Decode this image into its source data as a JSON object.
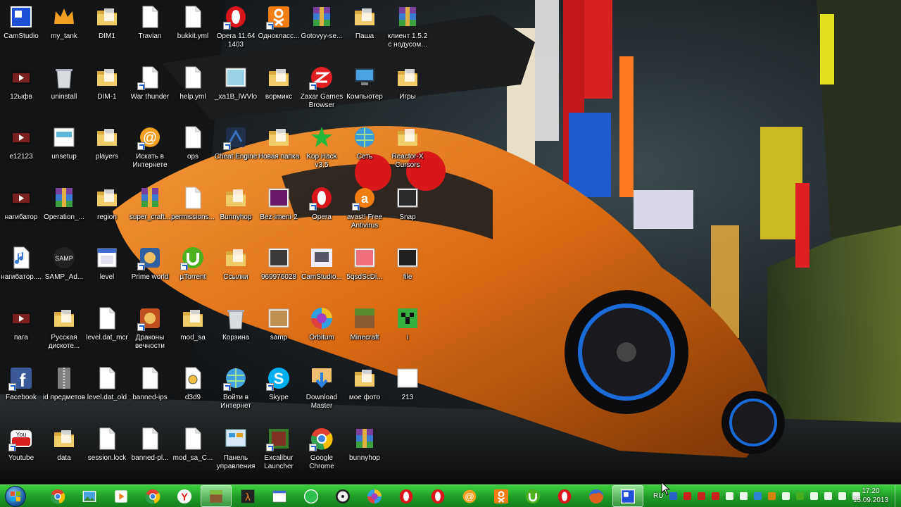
{
  "desktop": {
    "icons": [
      {
        "label": "CamStudio",
        "icon": "camstudio-icon",
        "color": "#1d4fd8",
        "shortcut": false
      },
      {
        "label": "my_tank",
        "icon": "tank-crown-icon",
        "color": "#f0a020",
        "shortcut": false
      },
      {
        "label": "DIM1",
        "icon": "folder-icon",
        "color": "#f1cd69",
        "shortcut": false
      },
      {
        "label": "Travian",
        "icon": "file-icon",
        "color": "#ffffff",
        "shortcut": false
      },
      {
        "label": "bukkit.yml",
        "icon": "file-icon",
        "color": "#ffffff",
        "shortcut": false
      },
      {
        "label": "Opera 11.64 1403",
        "icon": "opera-icon",
        "color": "#d9151b",
        "shortcut": true
      },
      {
        "label": "Однокласс...",
        "icon": "odnoklassniki-icon",
        "color": "#f57e14",
        "shortcut": true
      },
      {
        "label": "Gotovyy-se...",
        "icon": "winrar-icon",
        "color": "#7b3fa0",
        "shortcut": false
      },
      {
        "label": "Паша",
        "icon": "folder-icon",
        "color": "#f1cd69",
        "shortcut": false
      },
      {
        "label": "клиент 1.5.2 с нодусом...",
        "icon": "winrar-icon",
        "color": "#7b3fa0",
        "shortcut": false
      },
      {
        "label": "12ыфв",
        "icon": "video-file-icon",
        "color": "#ffffff",
        "shortcut": false
      },
      {
        "label": "uninstall",
        "icon": "recycle-bin-icon",
        "color": "#c8c8c8",
        "shortcut": false
      },
      {
        "label": "DIM-1",
        "icon": "folder-icon",
        "color": "#f1cd69",
        "shortcut": false
      },
      {
        "label": "War thunder",
        "icon": "file-icon",
        "color": "#ffffff",
        "shortcut": true
      },
      {
        "label": "help.yml",
        "icon": "file-icon",
        "color": "#ffffff",
        "shortcut": false
      },
      {
        "label": "_xa1B_lWVlo",
        "icon": "image-file-icon",
        "color": "#9ad0e8",
        "shortcut": false
      },
      {
        "label": "вормикс",
        "icon": "folder-icon",
        "color": "#f1cd69",
        "shortcut": false
      },
      {
        "label": "Zaxar Games Browser",
        "icon": "zaxar-icon",
        "color": "#e02020",
        "shortcut": true
      },
      {
        "label": "Компьютер",
        "icon": "computer-icon",
        "color": "#4aa3e0",
        "shortcut": false
      },
      {
        "label": "Игры",
        "icon": "folder-icon",
        "color": "#f1cd69",
        "shortcut": false
      },
      {
        "label": "e12123",
        "icon": "video-file-icon",
        "color": "#ffffff",
        "shortcut": false
      },
      {
        "label": "unsetup",
        "icon": "setup-window-icon",
        "color": "#5fb8d8",
        "shortcut": false
      },
      {
        "label": "players",
        "icon": "folder-icon",
        "color": "#f1cd69",
        "shortcut": false
      },
      {
        "label": "Искать в Интернете",
        "icon": "mail-at-icon",
        "color": "#f5a020",
        "shortcut": true
      },
      {
        "label": "ops",
        "icon": "file-icon",
        "color": "#ffffff",
        "shortcut": false
      },
      {
        "label": "Cheat Engine",
        "icon": "cheat-engine-icon",
        "color": "#3a70c0",
        "shortcut": true
      },
      {
        "label": "Новая папка",
        "icon": "folder-icon",
        "color": "#f1cd69",
        "shortcut": false
      },
      {
        "label": "Kop Hack v3.5",
        "icon": "star-icon",
        "color": "#22b83a",
        "shortcut": false
      },
      {
        "label": "Сеть",
        "icon": "network-globe-icon",
        "color": "#3a9ad9",
        "shortcut": false
      },
      {
        "label": "Reactor-X Cursors",
        "icon": "folder-icon",
        "color": "#f1cd69",
        "shortcut": false
      },
      {
        "label": "нагибатор",
        "icon": "video-file-icon",
        "color": "#ffffff",
        "shortcut": false
      },
      {
        "label": "Operation_...",
        "icon": "winrar-icon",
        "color": "#7b3fa0",
        "shortcut": false
      },
      {
        "label": "region",
        "icon": "folder-icon",
        "color": "#f1cd69",
        "shortcut": false
      },
      {
        "label": "super_craft...",
        "icon": "winrar-icon",
        "color": "#7b3fa0",
        "shortcut": false
      },
      {
        "label": "permissions...",
        "icon": "file-icon",
        "color": "#ffffff",
        "shortcut": false
      },
      {
        "label": "Bunnyhop",
        "icon": "folder-icon",
        "color": "#f1cd69",
        "shortcut": false
      },
      {
        "label": "Bez-imeni-2",
        "icon": "image-file-icon",
        "color": "#6a1a6a",
        "shortcut": false
      },
      {
        "label": "Opera",
        "icon": "opera-icon",
        "color": "#d9151b",
        "shortcut": true
      },
      {
        "label": "avast! Free Antivirus",
        "icon": "avast-icon",
        "color": "#f07d12",
        "shortcut": true
      },
      {
        "label": "Snap",
        "icon": "image-file-icon",
        "color": "#2a2a2a",
        "shortcut": false
      },
      {
        "label": "нагибатор....",
        "icon": "audio-file-icon",
        "color": "#ffffff",
        "shortcut": false
      },
      {
        "label": "SAMP_Ad...",
        "icon": "samp-icon",
        "color": "#555555",
        "shortcut": false
      },
      {
        "label": "level",
        "icon": "calendar-icon",
        "color": "#ffffff",
        "shortcut": false
      },
      {
        "label": "Prime world",
        "icon": "game-icon",
        "color": "#3060a0",
        "shortcut": true
      },
      {
        "label": "µTorrent",
        "icon": "utorrent-icon",
        "color": "#4cb01f",
        "shortcut": true
      },
      {
        "label": "Ссылки",
        "icon": "folder-icon",
        "color": "#f1cd69",
        "shortcut": false
      },
      {
        "label": "969976028",
        "icon": "image-file-icon",
        "color": "#3a3a3a",
        "shortcut": false
      },
      {
        "label": "CamStudio...",
        "icon": "camstudio-player-icon",
        "color": "#9aa0b0",
        "shortcut": false
      },
      {
        "label": "5qsdScDi...",
        "icon": "image-file-icon",
        "color": "#f07080",
        "shortcut": false
      },
      {
        "label": "file",
        "icon": "image-file-icon",
        "color": "#202020",
        "shortcut": false
      },
      {
        "label": "пага",
        "icon": "video-file-icon",
        "color": "#ffffff",
        "shortcut": false
      },
      {
        "label": "Русская дискоте...",
        "icon": "folder-icon",
        "color": "#f1cd69",
        "shortcut": false
      },
      {
        "label": "level.dat_mcr",
        "icon": "file-icon",
        "color": "#ffffff",
        "shortcut": false
      },
      {
        "label": "Драконы вечности",
        "icon": "game-icon",
        "color": "#c05020",
        "shortcut": true
      },
      {
        "label": "mod_sa",
        "icon": "folder-icon",
        "color": "#f1cd69",
        "shortcut": false
      },
      {
        "label": "Корзина",
        "icon": "recycle-bin-icon",
        "color": "#c8c8c8",
        "shortcut": false
      },
      {
        "label": "samp",
        "icon": "image-file-icon",
        "color": "#c09050",
        "shortcut": false
      },
      {
        "label": "Orbitum",
        "icon": "orbitum-icon",
        "color": "#a040c0",
        "shortcut": false
      },
      {
        "label": "Minecraft",
        "icon": "minecraft-icon",
        "color": "#5d8c2e",
        "shortcut": false
      },
      {
        "label": "i",
        "icon": "creeper-icon",
        "color": "#38b040",
        "shortcut": false
      },
      {
        "label": "Facebook",
        "icon": "facebook-icon",
        "color": "#3b5998",
        "shortcut": true
      },
      {
        "label": "id предметов",
        "icon": "archive-icon",
        "color": "#808080",
        "shortcut": false
      },
      {
        "label": "level.dat_old",
        "icon": "file-icon",
        "color": "#ffffff",
        "shortcut": false
      },
      {
        "label": "banned-ips",
        "icon": "file-icon",
        "color": "#ffffff",
        "shortcut": false
      },
      {
        "label": "d3d9",
        "icon": "dll-gear-icon",
        "color": "#f0c040",
        "shortcut": false
      },
      {
        "label": "Войти в Интернет",
        "icon": "internet-globe-icon",
        "color": "#40a0e0",
        "shortcut": true
      },
      {
        "label": "Skype",
        "icon": "skype-icon",
        "color": "#00aff0",
        "shortcut": true
      },
      {
        "label": "Download Master",
        "icon": "download-master-icon",
        "color": "#3080e0",
        "shortcut": false
      },
      {
        "label": "мое фото",
        "icon": "folder-icon",
        "color": "#f1cd69",
        "shortcut": false
      },
      {
        "label": "213",
        "icon": "image-file-icon",
        "color": "#ffffff",
        "shortcut": false
      },
      {
        "label": "Youtube",
        "icon": "youtube-icon",
        "color": "#d92020",
        "shortcut": true
      },
      {
        "label": "data",
        "icon": "folder-icon",
        "color": "#f1cd69",
        "shortcut": false
      },
      {
        "label": "session.lock",
        "icon": "file-icon",
        "color": "#ffffff",
        "shortcut": false
      },
      {
        "label": "banned-pl...",
        "icon": "file-icon",
        "color": "#ffffff",
        "shortcut": false
      },
      {
        "label": "mod_sa_C...",
        "icon": "file-icon",
        "color": "#ffffff",
        "shortcut": false
      },
      {
        "label": "Панель управления",
        "icon": "control-panel-icon",
        "color": "#4a90d0",
        "shortcut": false
      },
      {
        "label": "Excalibur Launcher",
        "icon": "excalibur-icon",
        "color": "#3a7a2a",
        "shortcut": true
      },
      {
        "label": "Google Chrome",
        "icon": "chrome-icon",
        "color": "#e04030",
        "shortcut": true
      },
      {
        "label": "bunnyhop",
        "icon": "winrar-icon",
        "color": "#7b3fa0",
        "shortcut": false
      }
    ]
  },
  "taskbar": {
    "start_icon": "windows-start-icon",
    "buttons": [
      {
        "icon": "chrome-icon",
        "color": "#e04030",
        "active": false
      },
      {
        "icon": "photo-viewer-icon",
        "color": "#4aa3e0",
        "active": false
      },
      {
        "icon": "media-player-icon",
        "color": "#f08020",
        "active": false
      },
      {
        "icon": "chrome-icon",
        "color": "#e04030",
        "active": false
      },
      {
        "icon": "yandex-browser-icon",
        "color": "#e02020",
        "active": false
      },
      {
        "icon": "minecraft-launcher-icon",
        "color": "#80c040",
        "active": true
      },
      {
        "icon": "half-life-icon",
        "color": "#f08020",
        "active": false
      },
      {
        "icon": "window-app-icon",
        "color": "#ffffff",
        "active": false
      },
      {
        "icon": "green-circle-icon",
        "color": "#30c050",
        "active": false
      },
      {
        "icon": "radiation-icon",
        "color": "#f0f0f0",
        "active": false
      },
      {
        "icon": "orbitum-icon",
        "color": "#a040c0",
        "active": false
      },
      {
        "icon": "opera-icon",
        "color": "#d9151b",
        "active": false
      },
      {
        "icon": "opera-icon",
        "color": "#d9151b",
        "active": false
      },
      {
        "icon": "mail-at-icon",
        "color": "#f5a020",
        "active": false
      },
      {
        "icon": "odnoklassniki-icon",
        "color": "#f57e14",
        "active": false
      },
      {
        "icon": "utorrent-icon",
        "color": "#4cb01f",
        "active": false
      },
      {
        "icon": "opera-icon",
        "color": "#d9151b",
        "active": false
      },
      {
        "icon": "firefox-icon",
        "color": "#e06020",
        "active": false
      },
      {
        "icon": "camstudio-icon",
        "color": "#1d4fd8",
        "active": true
      }
    ],
    "tray": {
      "lang": "RU",
      "icons": [
        {
          "icon": "tray-camstudio-icon",
          "color": "#2a5ad8"
        },
        {
          "icon": "tray-opera-icon",
          "color": "#d9151b"
        },
        {
          "icon": "tray-opera-icon",
          "color": "#d9151b"
        },
        {
          "icon": "tray-opera-icon",
          "color": "#d9151b"
        },
        {
          "icon": "tray-network-icon",
          "color": "#ffffff"
        },
        {
          "icon": "tray-usb-icon",
          "color": "#ffffff"
        },
        {
          "icon": "tray-download-icon",
          "color": "#3080e0"
        },
        {
          "icon": "tray-avast-icon",
          "color": "#f07d12"
        },
        {
          "icon": "tray-speaker-icon",
          "color": "#ffffff"
        },
        {
          "icon": "tray-utorrent-icon",
          "color": "#4cb01f"
        },
        {
          "icon": "tray-check-icon",
          "color": "#ffffff"
        },
        {
          "icon": "tray-flag-icon",
          "color": "#ffffff"
        },
        {
          "icon": "tray-battery-icon",
          "color": "#ffffff"
        },
        {
          "icon": "tray-volume-icon",
          "color": "#ffffff"
        }
      ]
    },
    "clock": {
      "time": "17:20",
      "date": "15.09.2013"
    }
  }
}
